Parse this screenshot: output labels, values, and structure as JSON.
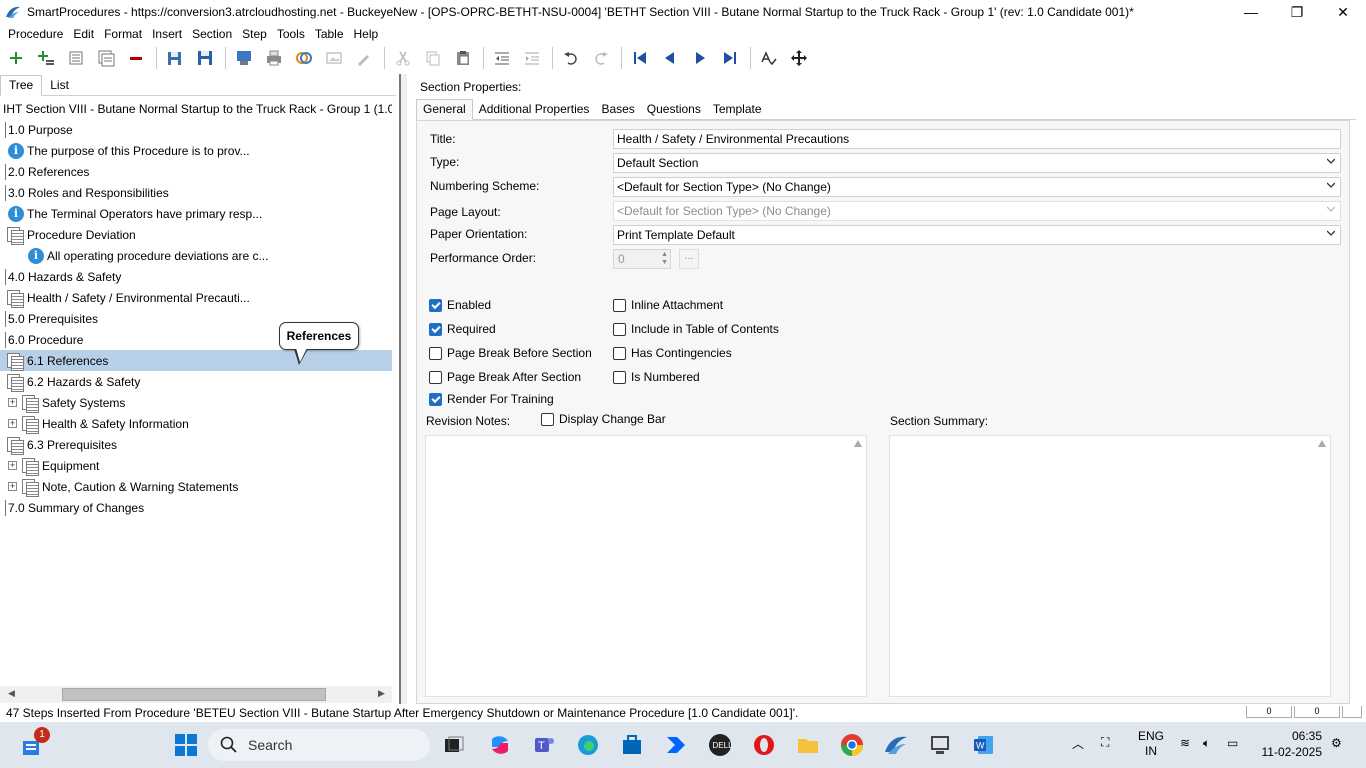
{
  "window": {
    "title": "SmartProcedures - https://conversion3.atrcloudhosting.net - BuckeyeNew - [OPS-OPRC-BETHT-NSU-0004] 'BETHT Section VIII - Butane Normal Startup to the Truck Rack - Group 1' (rev: 1.0 Candidate 001)*",
    "minimize": "—",
    "restore": "❐",
    "close": "✕"
  },
  "menu": [
    "Procedure",
    "Edit",
    "Format",
    "Insert",
    "Section",
    "Step",
    "Tools",
    "Table",
    "Help"
  ],
  "left": {
    "tabs": [
      "Tree",
      "List"
    ],
    "root": "IHT Section VIII - Butane Normal Startup to the Truck Rack - Group 1 (1.0...",
    "rows": [
      {
        "label": "1.0 Purpose"
      },
      {
        "label": "The purpose of this Procedure is to prov..."
      },
      {
        "label": "2.0 References"
      },
      {
        "label": "3.0 Roles and Responsibilities"
      },
      {
        "label": "The Terminal Operators have primary resp..."
      },
      {
        "label": "Procedure Deviation"
      },
      {
        "label": "All operating procedure deviations are c..."
      },
      {
        "label": "4.0 Hazards & Safety"
      },
      {
        "label": "Health / Safety / Environmental Precauti..."
      },
      {
        "label": "5.0 Prerequisites"
      },
      {
        "label": "6.0 Procedure"
      },
      {
        "label": "6.1 References"
      },
      {
        "label": "6.2 Hazards & Safety"
      },
      {
        "label": "Safety Systems"
      },
      {
        "label": "Health & Safety Information"
      },
      {
        "label": "6.3 Prerequisites"
      },
      {
        "label": "Equipment"
      },
      {
        "label": "Note, Caution & Warning Statements"
      },
      {
        "label": "7.0 Summary of Changes"
      }
    ],
    "tooltip": "References"
  },
  "right": {
    "section_label": "Section Properties:",
    "tabs": [
      "General",
      "Additional Properties",
      "Bases",
      "Questions",
      "Template"
    ],
    "labels": {
      "title": "Title:",
      "type": "Type:",
      "numbering": "Numbering Scheme:",
      "layout": "Page Layout:",
      "orientation": "Paper Orientation:",
      "perf": "Performance Order:",
      "revision_notes": "Revision Notes:",
      "summary": "Section Summary:"
    },
    "values": {
      "title": "Health / Safety / Environmental Precautions",
      "type": "Default Section",
      "numbering": "<Default for Section Type> (No Change)",
      "layout": "<Default for Section Type> (No Change)",
      "orientation": "Print Template Default",
      "perf": "0",
      "ellipsis": "..."
    },
    "checkboxes": {
      "enabled": {
        "label": "Enabled",
        "checked": true
      },
      "required": {
        "label": "Required",
        "checked": true
      },
      "pb_before": {
        "label": "Page Break Before Section",
        "checked": false
      },
      "pb_after": {
        "label": "Page Break After Section",
        "checked": false
      },
      "render_training": {
        "label": "Render For Training",
        "checked": true
      },
      "inline_attachment": {
        "label": "Inline Attachment",
        "checked": false
      },
      "include_toc": {
        "label": "Include in Table of Contents",
        "checked": false
      },
      "has_contingencies": {
        "label": "Has Contingencies",
        "checked": false
      },
      "is_numbered": {
        "label": "Is Numbered",
        "checked": false
      },
      "display_change_bar": {
        "label": "Display Change Bar",
        "checked": false
      }
    }
  },
  "status": {
    "message": "47 Steps Inserted From Procedure 'BETEU Section VIII - Butane Startup After Emergency Shutdown or Maintenance Procedure [1.0 Candidate 001]'.",
    "pane1": "0",
    "pane2": "0"
  },
  "taskbar": {
    "search_placeholder": "Search",
    "notification_badge": "1",
    "lang": "ENG",
    "region": "IN",
    "time": "06:35",
    "date": "11-02-2025"
  },
  "colors": {
    "selection": "#b8cfe8",
    "accent": "#1f6fc5",
    "info_icon": "#2e8fd8"
  }
}
